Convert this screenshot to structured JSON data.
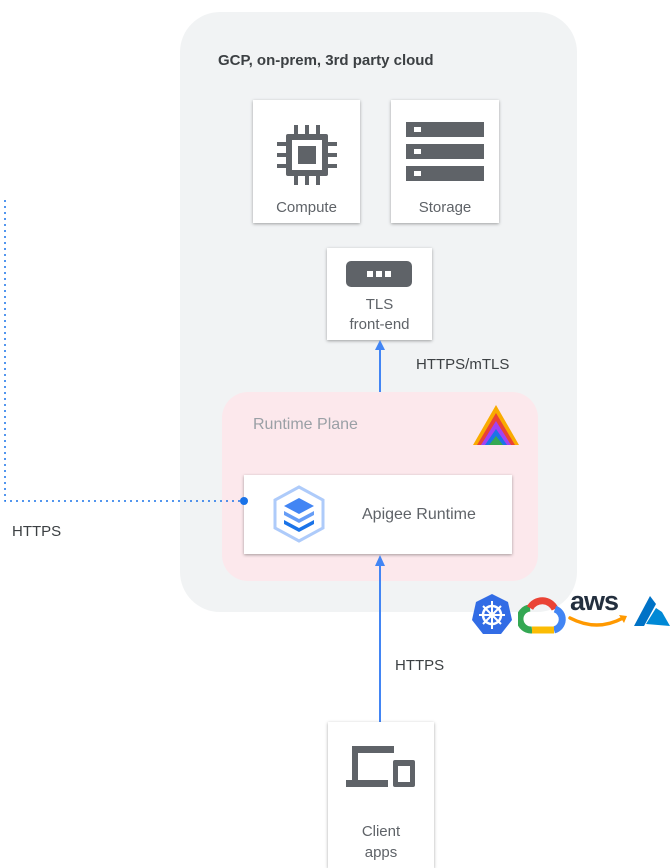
{
  "region": {
    "title": "GCP, on-prem, 3rd party cloud"
  },
  "compute": {
    "label": "Compute"
  },
  "storage": {
    "label": "Storage"
  },
  "tls": {
    "line1": "TLS",
    "line2": "front-end"
  },
  "runtime_plane": {
    "title": "Runtime Plane"
  },
  "apigee_runtime": {
    "label": "Apigee Runtime"
  },
  "client": {
    "line1": "Client",
    "line2": "apps"
  },
  "edges": {
    "https_mtls": "HTTPS/mTLS",
    "https_left": "HTTPS",
    "https_bottom": "HTTPS"
  },
  "logos": {
    "aws_text": "aws",
    "icons": [
      "kubernetes-icon",
      "google-cloud-icon",
      "aws-icon",
      "azure-icon"
    ]
  },
  "colors": {
    "arrow_blue": "#4285f4",
    "dotted_blue": "#1a73e8",
    "region_gray": "#f1f3f4",
    "runtime_pink": "#fce8ec",
    "icon_gray": "#5f6368"
  }
}
